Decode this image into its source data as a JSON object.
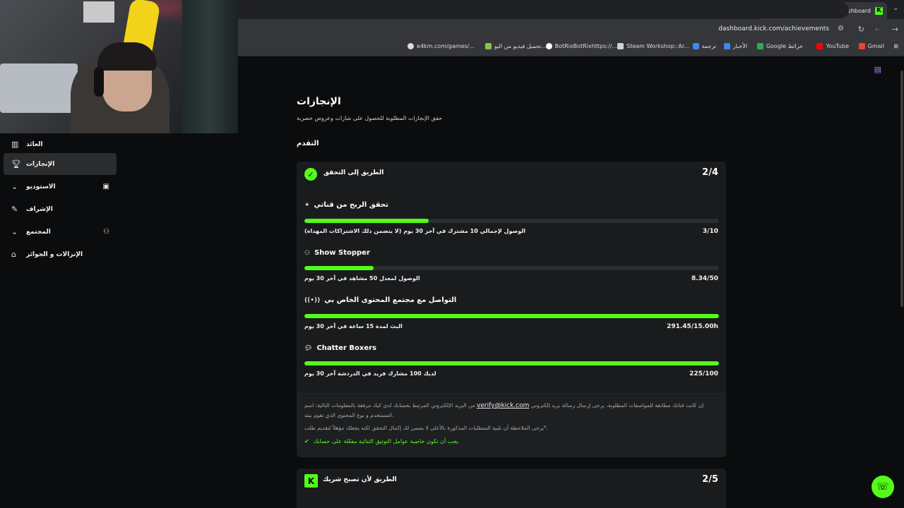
{
  "browser": {
    "tab_title": "Achievements - Kick Dashboard",
    "tab_favicon": "K",
    "tab_close": "×",
    "new_tab": "+",
    "tab_menu": "⌄",
    "url": "dashboard.kick.com/achievements",
    "bookmarks": [
      {
        "label": "Gmail",
        "color": "#ea4335"
      },
      {
        "label": "YouTube",
        "color": "#ff0000"
      },
      {
        "label": "Google خرائط",
        "color": "#34a853"
      },
      {
        "label": "الأخبار",
        "color": "#4285f4"
      },
      {
        "label": "ترجمة",
        "color": "#4285f4"
      },
      {
        "label": "Steam Workshop::Ar...",
        "color": "#1b2838"
      },
      {
        "label": "BotRixBotRixhttps://...",
        "color": "#ffffff"
      },
      {
        "label": "تحميل فيديو من اليو...",
        "color": "#8bc34a"
      },
      {
        "label": "e4km.com/games/...",
        "color": "#dddddd"
      }
    ]
  },
  "sidebar": {
    "items": [
      {
        "label": "العائد",
        "icon": "chart-icon"
      },
      {
        "label": "الإنجازات",
        "icon": "trophy-icon"
      },
      {
        "label": "الاستوديو",
        "icon": "studio-icon"
      },
      {
        "label": "الإشراف",
        "icon": "wrench-icon"
      },
      {
        "label": "المجتمع",
        "icon": "community-icon"
      },
      {
        "label": "الإنزالات و الجوائز",
        "icon": "gift-icon"
      }
    ]
  },
  "main": {
    "title": "الإنجازات",
    "subtitle": "حقق الإنجازات المطلوبة للحصول على شارات وعروض حصرية",
    "section": "التقدم"
  },
  "card1": {
    "title": "الطريق إلى التحقق",
    "count": "2/4",
    "requirements": [
      {
        "title": "تحقق الربح من قناتي",
        "icon": "sparkle-icon",
        "desc": "الوصول لإجمالي 10 مشترك في آخر 30 يوم (لا يتضمن ذلك الاشتراكات المهداة)",
        "value": "3/10",
        "progress": 0.3
      },
      {
        "title": "Show Stopper",
        "icon": "users-icon",
        "desc": "الوصول لمعدل 50 مشاهد في آخر 30 يوم",
        "value": "8.34/50",
        "progress": 0.167
      },
      {
        "title": "التواصل مع مجتمع المحتوى الخاص بي",
        "icon": "broadcast-icon",
        "desc": "البث لمدة 15 ساعة في آخر 30 يوم",
        "value": "291.45/15.00h",
        "progress": 1.0
      },
      {
        "title": "Chatter Boxers",
        "icon": "chat-icon",
        "desc": "لديك 100 مشارك فريد في الدردشة آخر 30 يوم",
        "value": "225/100",
        "progress": 1.0
      }
    ],
    "info_line1": "إن كانت قناتك مطابقة للمواصفات المطلوبة، يرجى إرسال رسالة بريد إلكتروني",
    "info_email": "verify@kick.com",
    "info_line1b": "من البريد الإلكتروني المرتبط بحسابك لدى كيك مرفقة بالمعلومات التالية: اسم",
    "info_line2": "المستخدم و نوع المحتوى الذي تقوم ببثه.",
    "info_line3": "يرجى الملاحظة أن تلبية المتطلبات المذكورة بالأعلى لا يضمن لك إكمال التحقق لكنه يجعلك مؤهلاً لتقديم طلب*.",
    "info_ok": "يجب أن تكون خاصية عوامل التوثيق الثنائية مفعّلة على حسابك"
  },
  "card2": {
    "badge": "K",
    "title": "الطريق لأن تصبح شريك",
    "count": "2/5"
  },
  "colors": {
    "accent": "#53fc18",
    "background": "#0b0c0d",
    "card": "#191b1d"
  }
}
